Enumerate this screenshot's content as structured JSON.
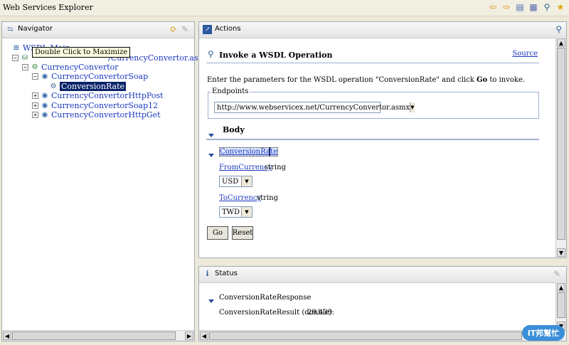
{
  "window": {
    "title": "Web Services Explorer"
  },
  "toolbar": {
    "icons": [
      "back-arrow-icon",
      "forward-arrow-icon",
      "uddi-page-icon",
      "wsil-page-icon",
      "wsdl-page-icon",
      "favorites-icon"
    ]
  },
  "navigator": {
    "title": "Navigator",
    "tooltip": "Double Click to Maximize",
    "tree": [
      {
        "label": "WSDL Main",
        "level": 0
      },
      {
        "label": "/CurrencyConvertor.asmx?W",
        "level": 1
      },
      {
        "label": "CurrencyConvertor",
        "level": 2
      },
      {
        "label": "CurrencyConvertorSoap",
        "level": 3
      },
      {
        "label": "ConversionRate",
        "level": 4,
        "selected": true
      },
      {
        "label": "CurrencyConvertorHttpPost",
        "level": 3
      },
      {
        "label": "CurrencyConvertorSoap12",
        "level": 3
      },
      {
        "label": "CurrencyConvertorHttpGet",
        "level": 3
      }
    ]
  },
  "actions": {
    "title": "Actions",
    "heading": "Invoke a WSDL Operation",
    "source_link": "Source",
    "instruction_prefix": "Enter the parameters for the WSDL operation \"ConversionRate\" and click ",
    "instruction_bold": "Go",
    "instruction_suffix": " to invoke.",
    "endpoints_label": "Endpoints",
    "endpoint_value": "http://www.webservicex.net/CurrencyConvertor.asmx",
    "body_label": "Body",
    "operation_link": "ConversionRate",
    "params": [
      {
        "name": "FromCurrency",
        "type": "string",
        "value": "USD"
      },
      {
        "name": "ToCurrency",
        "type": "string",
        "value": "TWD"
      }
    ],
    "go_label": "Go",
    "reset_label": "Reset"
  },
  "status": {
    "title": "Status",
    "response_label": "ConversionRateResponse",
    "result_label": "ConversionRateResult (double):",
    "result_value": "29.439"
  },
  "watermark": {
    "text": "IT邦幫忙"
  }
}
